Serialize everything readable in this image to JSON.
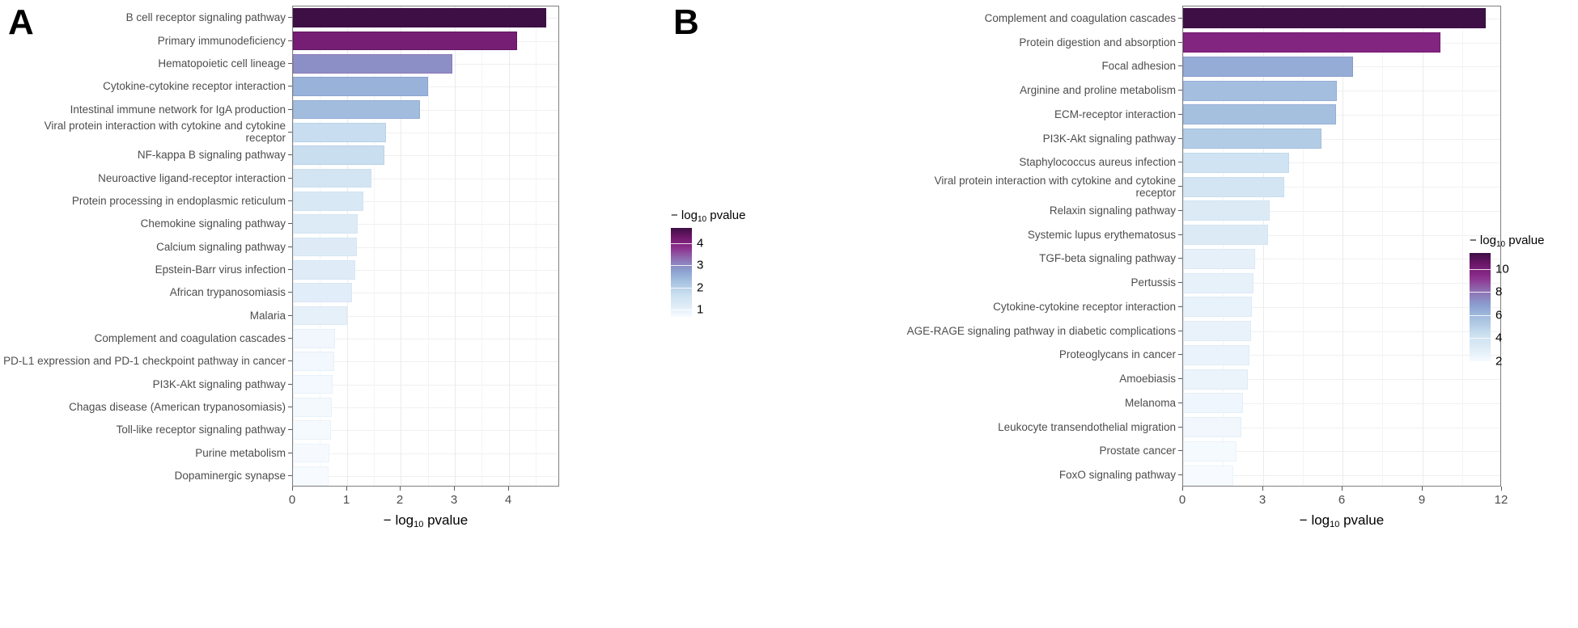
{
  "figure": {
    "panels": [
      {
        "letter": "A",
        "axis_title": "− log10 pvalue",
        "axis_title_base": "− log",
        "axis_title_sub": "10",
        "axis_title_tail": " pvalue",
        "legend_title_base": "− log",
        "legend_title_sub": "10",
        "legend_title_tail": " pvalue",
        "xticks": [
          "0",
          "1",
          "2",
          "3",
          "4"
        ],
        "legend_ticks": [
          "4",
          "3",
          "2",
          "1"
        ]
      },
      {
        "letter": "B",
        "axis_title": "− log10 pvalue",
        "axis_title_base": "− log",
        "axis_title_sub": "10",
        "axis_title_tail": " pvalue",
        "legend_title_base": "− log",
        "legend_title_sub": "10",
        "legend_title_tail": " pvalue",
        "xticks": [
          "0",
          "3",
          "6",
          "9",
          "12"
        ],
        "legend_ticks": [
          "10",
          "8",
          "6",
          "4",
          "2"
        ]
      }
    ]
  },
  "colors": {
    "low": "#f7fbff",
    "mid_blue": "#9ebfdd",
    "mid_purple": "#8f74b5",
    "high": "#3d0f45",
    "axis": "#595959",
    "text": "#4d4d4d",
    "grid_major": "#ebebeb",
    "grid_minor": "#f4f4f4"
  },
  "chart_data": [
    {
      "type": "bar",
      "panel": "A",
      "orientation": "horizontal",
      "title": "",
      "xlabel": "− log10 pvalue",
      "ylabel": "",
      "xlim": [
        0,
        4.95
      ],
      "xticks": [
        0,
        1,
        2,
        3,
        4
      ],
      "grid": true,
      "legend": {
        "title": "− log10 pvalue",
        "position": "right",
        "ticks": [
          4,
          3,
          2,
          1
        ],
        "vmin": 0.66,
        "vmax": 4.7
      },
      "categories": [
        "B cell receptor signaling pathway",
        "Primary immunodeficiency",
        "Hematopoietic cell lineage",
        "Cytokine-cytokine receptor interaction",
        "Intestinal immune network for IgA production",
        "Viral protein interaction with cytokine and cytokine receptor",
        "NF-kappa B signaling pathway",
        "Neuroactive ligand-receptor interaction",
        "Protein processing in endoplasmic reticulum",
        "Chemokine signaling pathway",
        "Calcium signaling pathway",
        "Epstein-Barr virus infection",
        "African trypanosomiasis",
        "Malaria",
        "Complement and coagulation cascades",
        "PD-L1 expression and PD-1 checkpoint pathway in cancer",
        "PI3K-Akt signaling pathway",
        "Chagas disease (American trypanosomiasis)",
        "Toll-like receptor signaling pathway",
        "Purine metabolism",
        "Dopaminergic synapse"
      ],
      "values": [
        4.7,
        4.15,
        2.95,
        2.5,
        2.35,
        1.72,
        1.7,
        1.45,
        1.3,
        1.2,
        1.18,
        1.15,
        1.1,
        1.0,
        0.78,
        0.76,
        0.74,
        0.72,
        0.7,
        0.68,
        0.66
      ]
    },
    {
      "type": "bar",
      "panel": "B",
      "orientation": "horizontal",
      "title": "",
      "xlabel": "− log10 pvalue",
      "ylabel": "",
      "xlim": [
        0,
        12
      ],
      "xticks": [
        0,
        3,
        6,
        9,
        12
      ],
      "grid": true,
      "legend": {
        "title": "− log10 pvalue",
        "position": "right",
        "ticks": [
          10,
          8,
          6,
          4,
          2
        ],
        "vmin": 1.9,
        "vmax": 11.4
      },
      "categories": [
        "Complement and coagulation cascades",
        "Protein digestion and absorption",
        "Focal adhesion",
        "Arginine and proline metabolism",
        "ECM-receptor interaction",
        "PI3K-Akt signaling pathway",
        "Staphylococcus aureus infection",
        "Viral protein interaction with cytokine and cytokine receptor",
        "Relaxin signaling pathway",
        "Systemic lupus erythematosus",
        "TGF-beta signaling pathway",
        "Pertussis",
        "Cytokine-cytokine receptor interaction",
        "AGE-RAGE signaling pathway in diabetic complications",
        "Proteoglycans in cancer",
        "Amoebiasis",
        "Melanoma",
        "Leukocyte transendothelial migration",
        "Prostate cancer",
        "FoxO signaling pathway"
      ],
      "values": [
        11.4,
        9.7,
        6.4,
        5.8,
        5.75,
        5.2,
        4.0,
        3.8,
        3.25,
        3.2,
        2.7,
        2.65,
        2.6,
        2.55,
        2.5,
        2.45,
        2.25,
        2.2,
        2.0,
        1.9
      ]
    }
  ]
}
